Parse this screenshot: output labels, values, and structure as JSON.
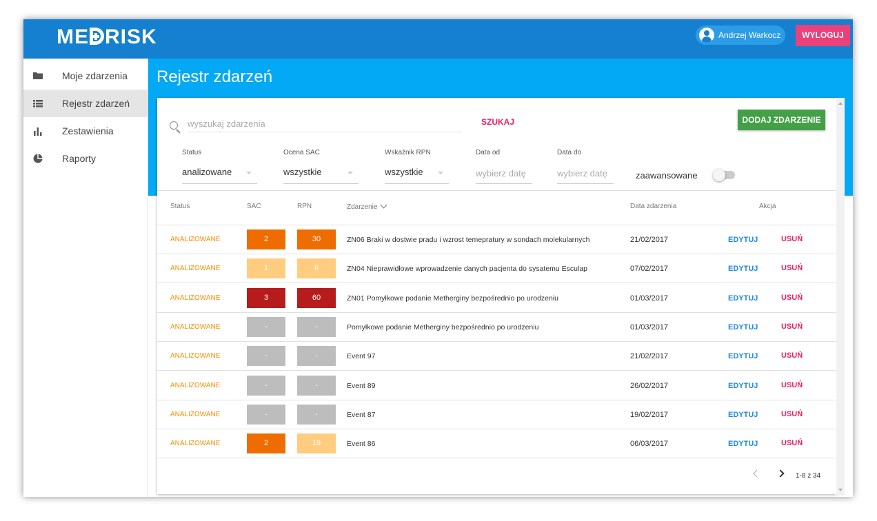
{
  "app": {
    "logo_text_1": "ME",
    "logo_text_2": "RISK"
  },
  "header": {
    "user_name": "Andrzej Warkocz",
    "logout_label": "WYLOGUJ"
  },
  "sidebar": {
    "items": [
      {
        "label": "Moje zdarzenia",
        "icon": "folder-icon"
      },
      {
        "label": "Rejestr zdarzeń",
        "icon": "list-icon",
        "active": true
      },
      {
        "label": "Zestawienia",
        "icon": "bar-chart-icon"
      },
      {
        "label": "Raporty",
        "icon": "pie-chart-icon"
      }
    ]
  },
  "page": {
    "title": "Rejestr zdarzeń"
  },
  "search": {
    "placeholder": "wyszukaj zdarzenia",
    "button_label": "SZUKAJ",
    "add_label": "DODAJ ZDARZENIE"
  },
  "filters": {
    "status": {
      "label": "Status",
      "value": "analizowane"
    },
    "sac": {
      "label": "Ocena SAC",
      "value": "wszystkie"
    },
    "rpn": {
      "label": "Wskaźnik RPN",
      "value": "wszystkie"
    },
    "date_from": {
      "label": "Data od",
      "placeholder": "wybierz datę"
    },
    "date_to": {
      "label": "Data do",
      "placeholder": "wybierz datę"
    },
    "advanced_label": "zaawansowane",
    "advanced_on": false
  },
  "table": {
    "columns": {
      "status": "Status",
      "sac": "SAC",
      "rpn": "RPN",
      "event": "Zdarzenie",
      "date": "Data zdarzenia",
      "action": "Akcja"
    },
    "edit_label": "EDYTUJ",
    "delete_label": "USUŃ",
    "rows": [
      {
        "status": "ANALIZOWANE",
        "sac": "2",
        "sac_color": "#ef6c00",
        "rpn": "30",
        "rpn_color": "#ef6c00",
        "event": "ZN06 Braki w dostwie pradu i wzrost temepratury w sondach molekularnych",
        "date": "21/02/2017"
      },
      {
        "status": "ANALIZOWANE",
        "sac": "1",
        "sac_color": "#ffcc80",
        "rpn": "6",
        "rpn_color": "#ffcc80",
        "event": "ZN04 Nieprawidłowe wprowadzenie danych pacjenta do sysatemu Esculap",
        "date": "07/02/2017"
      },
      {
        "status": "ANALIZOWANE",
        "sac": "3",
        "sac_color": "#b71c1c",
        "rpn": "60",
        "rpn_color": "#b71c1c",
        "event": "ZN01 Pomyłkowe podanie Metherginy bezpośrednio po urodzeniu",
        "date": "01/03/2017"
      },
      {
        "status": "ANALIZOWANE",
        "sac": "-",
        "sac_color": "#bdbdbd",
        "rpn": "-",
        "rpn_color": "#bdbdbd",
        "event": "Pomyłkowe podanie Metherginy bezpośrednio po urodzeniu",
        "date": "01/03/2017"
      },
      {
        "status": "ANALIZOWANE",
        "sac": "-",
        "sac_color": "#bdbdbd",
        "rpn": "-",
        "rpn_color": "#bdbdbd",
        "event": "Event 97",
        "date": "21/02/2017"
      },
      {
        "status": "ANALIZOWANE",
        "sac": "-",
        "sac_color": "#bdbdbd",
        "rpn": "-",
        "rpn_color": "#bdbdbd",
        "event": "Event 89",
        "date": "26/02/2017"
      },
      {
        "status": "ANALIZOWANE",
        "sac": "-",
        "sac_color": "#bdbdbd",
        "rpn": "-",
        "rpn_color": "#bdbdbd",
        "event": "Event 87",
        "date": "19/02/2017"
      },
      {
        "status": "ANALIZOWANE",
        "sac": "2",
        "sac_color": "#ef6c00",
        "rpn": "19",
        "rpn_color": "#ffcc80",
        "event": "Event 86",
        "date": "06/03/2017"
      }
    ]
  },
  "pagination": {
    "info": "1-8 z 34"
  },
  "colors": {
    "topbar": "#1580cf",
    "band": "#03a9f4",
    "logout": "#ec407a",
    "add": "#43a047",
    "status": "#fb8c00",
    "edit": "#1e88e5",
    "delete": "#e91e63"
  }
}
